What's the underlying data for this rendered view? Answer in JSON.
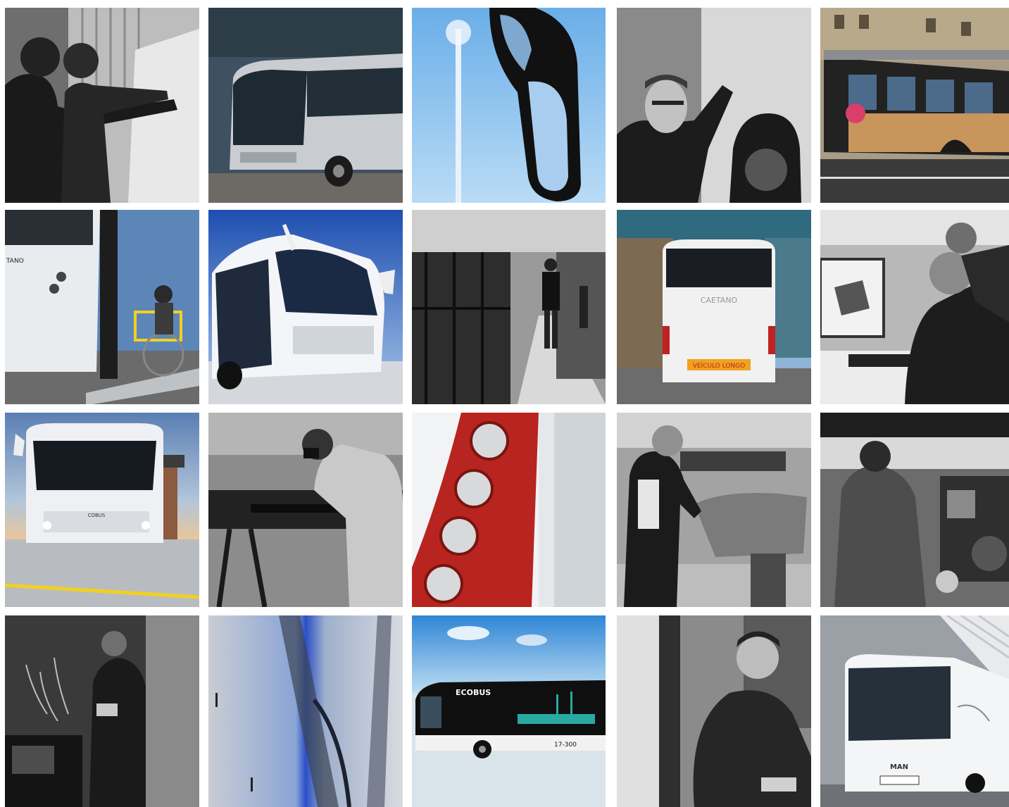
{
  "tiles": [
    {
      "id": 1,
      "subject": "two-men-pointing-at-drawing-board",
      "mono": true
    },
    {
      "id": 2,
      "subject": "silver-coach-bus-front",
      "mono": false
    },
    {
      "id": 3,
      "subject": "bus-side-mirror-blue-sky",
      "mono": false
    },
    {
      "id": 4,
      "subject": "man-inspecting-bus-wheel",
      "mono": true
    },
    {
      "id": 5,
      "subject": "city-bus-wood-panels-street",
      "mono": false
    },
    {
      "id": 6,
      "subject": "wheelchair-ramp-bus",
      "mono": false,
      "text": "TANO"
    },
    {
      "id": 7,
      "subject": "white-coach-bus-blue-sky",
      "mono": false
    },
    {
      "id": 8,
      "subject": "factory-assembly-line-workers",
      "mono": true
    },
    {
      "id": 9,
      "subject": "white-coach-rear-view",
      "mono": false,
      "text": "CAETANO",
      "plate": "VEÍCULO LONGO"
    },
    {
      "id": 10,
      "subject": "engineers-at-cad-screen",
      "mono": true
    },
    {
      "id": 11,
      "subject": "airport-bus-front-control-tower",
      "mono": false,
      "text": "COBUS"
    },
    {
      "id": 12,
      "subject": "welder-chassis-frame",
      "mono": true
    },
    {
      "id": 13,
      "subject": "red-bus-tail-lights",
      "mono": false
    },
    {
      "id": 14,
      "subject": "upholsterer-seat-work",
      "mono": true
    },
    {
      "id": 15,
      "subject": "mechanic-engine-bay",
      "mono": true
    },
    {
      "id": 16,
      "subject": "electrician-wiring-workshop",
      "mono": true
    },
    {
      "id": 17,
      "subject": "bus-interior-blue-light-detail",
      "mono": false
    },
    {
      "id": 18,
      "subject": "ecobus-airport-apron",
      "mono": false,
      "text": "ECOBUS",
      "number": "17-300"
    },
    {
      "id": 19,
      "subject": "worker-inside-bus",
      "mono": true
    },
    {
      "id": 20,
      "subject": "man-city-bus-front",
      "mono": false,
      "text": "MAN"
    }
  ],
  "colors": {
    "sky": "#7fb8ec",
    "red": "#b8241f",
    "yellow": "#f2d020",
    "wood": "#c8955c"
  }
}
